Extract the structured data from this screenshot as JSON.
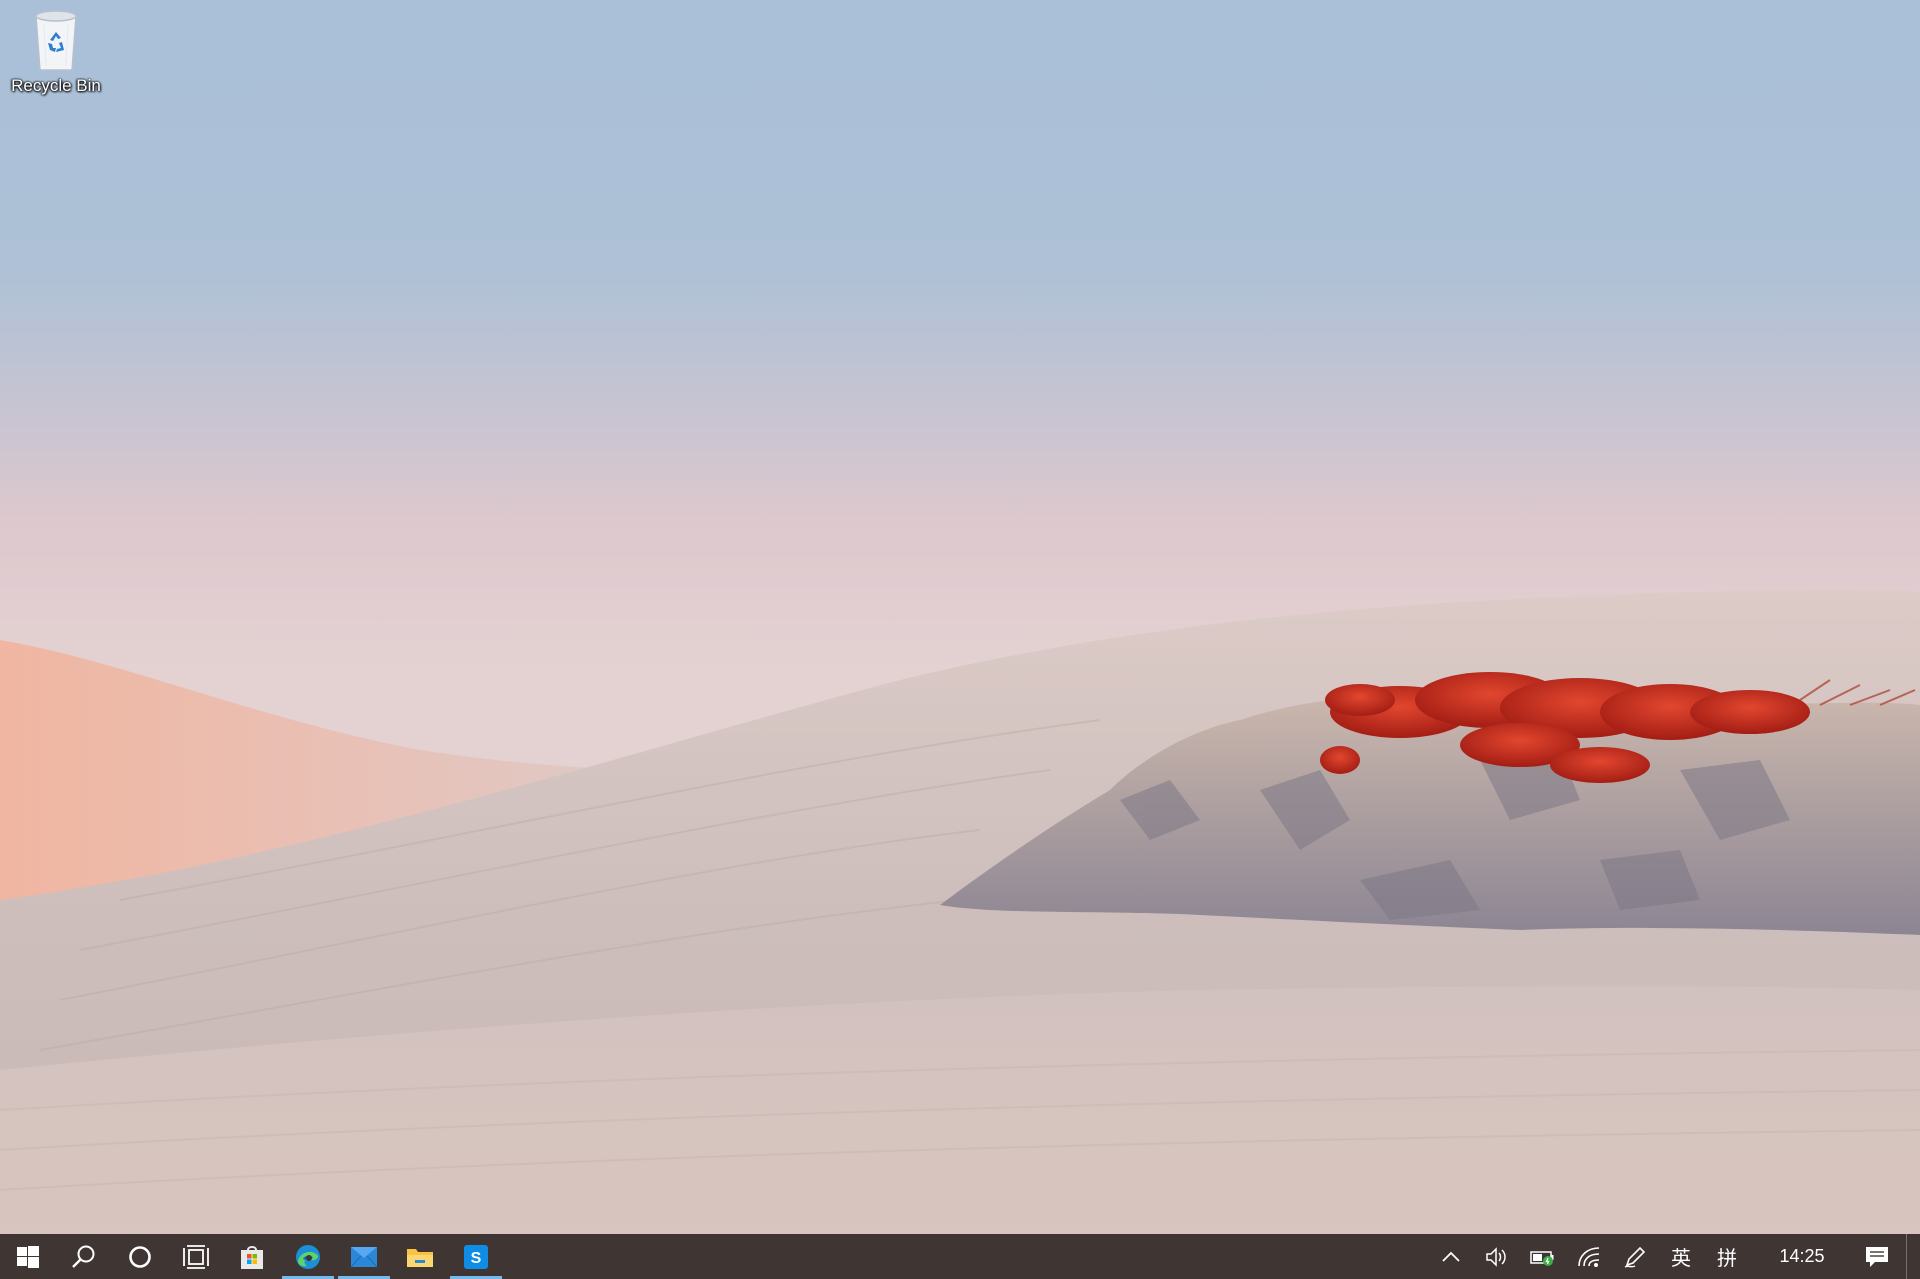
{
  "desktop": {
    "icons": [
      {
        "label": "Recycle Bin",
        "icon": "recycle-bin-icon"
      }
    ]
  },
  "taskbar": {
    "pinned": [
      {
        "name": "start",
        "icon": "windows-logo-icon"
      },
      {
        "name": "search",
        "icon": "search-icon"
      },
      {
        "name": "cortana",
        "icon": "cortana-circle-icon"
      },
      {
        "name": "task-view",
        "icon": "task-view-icon"
      },
      {
        "name": "microsoft-store",
        "icon": "store-bag-icon"
      },
      {
        "name": "edge",
        "icon": "edge-icon",
        "active": true
      },
      {
        "name": "mail",
        "icon": "mail-envelope-icon",
        "active": true
      },
      {
        "name": "file-explorer",
        "icon": "folder-icon"
      },
      {
        "name": "skype",
        "icon": "skype-icon",
        "active": true
      }
    ],
    "tray": {
      "ime_mode": "英",
      "ime_layout": "拼",
      "clock": "14:25"
    }
  },
  "colors": {
    "taskbar_bg": "#3f3533",
    "active_indicator": "#76b9ed",
    "sky_top": "#a9c0d8",
    "dune_light": "#d9c6c3",
    "dune_pink": "#eab5a2",
    "shrub_red": "#c8281a"
  }
}
